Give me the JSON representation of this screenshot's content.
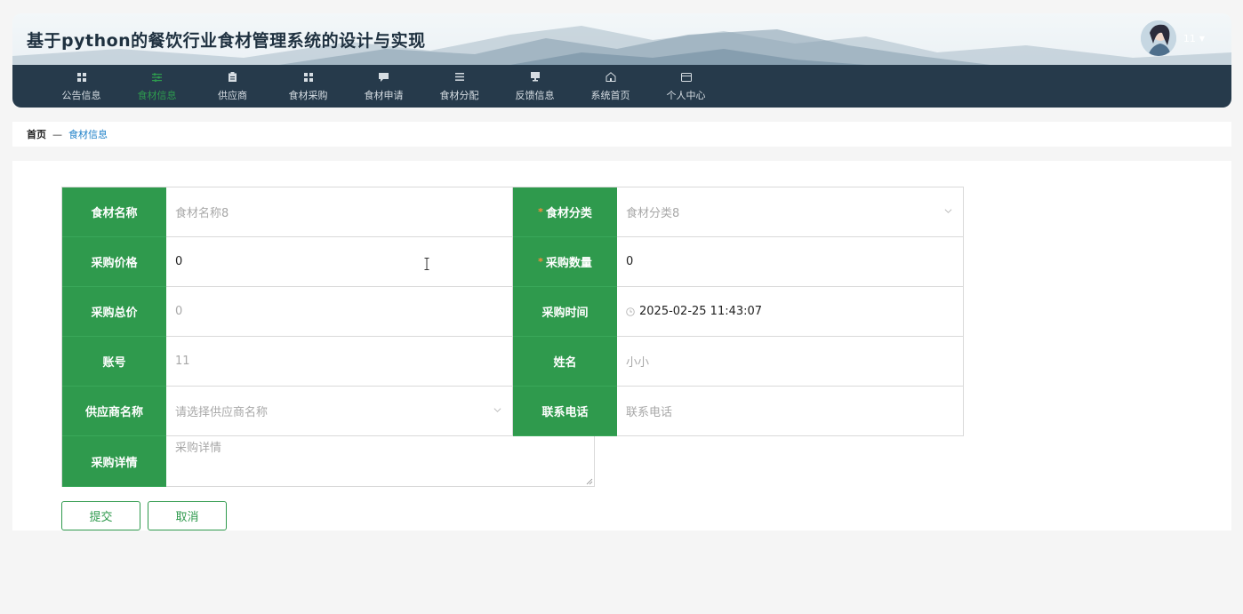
{
  "header": {
    "title": "基于python的餐饮行业食材管理系统的设计与实现",
    "user_name": "11"
  },
  "nav": {
    "items": [
      {
        "label": "公告信息",
        "icon": "grid-icon"
      },
      {
        "label": "食材信息",
        "icon": "sliders-icon",
        "active": true
      },
      {
        "label": "供应商",
        "icon": "clipboard-icon"
      },
      {
        "label": "食材采购",
        "icon": "grid-icon"
      },
      {
        "label": "食材申请",
        "icon": "chat-icon"
      },
      {
        "label": "食材分配",
        "icon": "menu-icon"
      },
      {
        "label": "反馈信息",
        "icon": "monitor-icon"
      },
      {
        "label": "系统首页",
        "icon": "home-icon"
      },
      {
        "label": "个人中心",
        "icon": "wallet-icon"
      }
    ]
  },
  "breadcrumb": {
    "home": "首页",
    "separator": "—",
    "current": "食材信息"
  },
  "form": {
    "food_name": {
      "label": "食材名称",
      "value": "",
      "placeholder": "食材名称8"
    },
    "food_category": {
      "label": "食材分类",
      "value": "",
      "placeholder": "食材分类8",
      "required": true
    },
    "purchase_price": {
      "label": "采购价格",
      "value": "0",
      "placeholder": ""
    },
    "purchase_qty": {
      "label": "采购数量",
      "value": "0",
      "placeholder": "",
      "required": true
    },
    "purchase_total": {
      "label": "采购总价",
      "value": "0"
    },
    "purchase_time": {
      "label": "采购时间",
      "value": "2025-02-25 11:43:07"
    },
    "account": {
      "label": "账号",
      "value": "11"
    },
    "name": {
      "label": "姓名",
      "value": "小小"
    },
    "supplier_name": {
      "label": "供应商名称",
      "value": "",
      "placeholder": "请选择供应商名称"
    },
    "contact_phone": {
      "label": "联系电话",
      "value": "",
      "placeholder": "联系电话"
    },
    "purchase_detail": {
      "label": "采购详情",
      "value": "",
      "placeholder": "采购详情"
    }
  },
  "buttons": {
    "submit": "提交",
    "cancel": "取消"
  },
  "colors": {
    "accent": "#2f9a4d",
    "nav_bg": "#263a4b",
    "link": "#1e80c8"
  }
}
